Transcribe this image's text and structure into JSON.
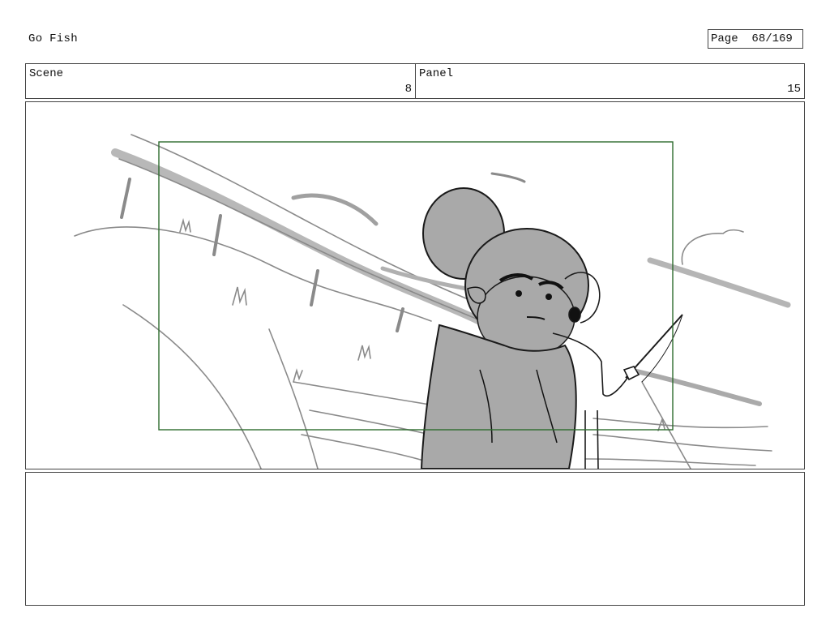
{
  "header": {
    "title": "Go Fish",
    "page_label": "Page",
    "page_value": "68/169"
  },
  "info": {
    "scene_label": "Scene",
    "scene_value": "8",
    "panel_label": "Panel",
    "panel_value": "15"
  },
  "notes": {
    "text": ""
  },
  "colors": {
    "border": "#444444",
    "camera_frame": "#2e6b2e",
    "sketch_gray": "#a9a9a9",
    "line": "#1a1a1a"
  }
}
